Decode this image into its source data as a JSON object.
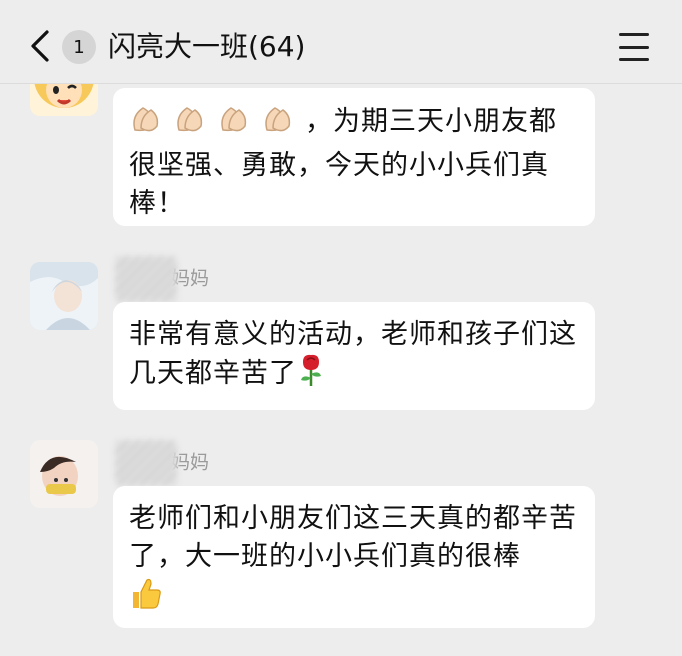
{
  "header": {
    "back_icon": "chevron-left-icon",
    "unread_count": "1",
    "title": "闪亮大一班(64)",
    "menu_icon": "menu-icon"
  },
  "messages": [
    {
      "sender": "",
      "text_suffix": "，为期三天小朋友都很坚强、勇敢，今天的小小兵们真棒！",
      "emoji": "clapping-hands ×4"
    },
    {
      "sender": "妈妈",
      "text": "非常有意义的活动，老师和孩子们这几天都辛苦了",
      "emoji": "rose-icon"
    },
    {
      "sender": "妈妈",
      "text": "老师们和小朋友们这三天真的都辛苦了，大一班的小小兵们真的很棒",
      "emoji": "thumbs-up-icon"
    }
  ]
}
